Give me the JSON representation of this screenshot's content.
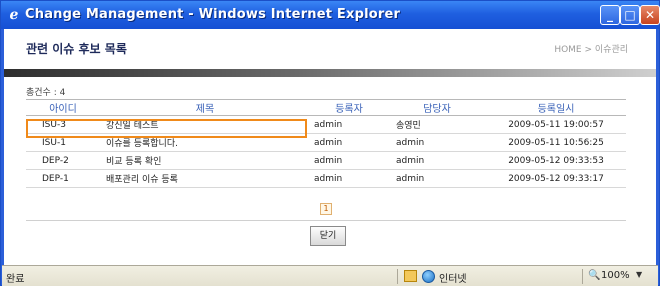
{
  "window": {
    "title": "Change Management - Windows Internet Explorer",
    "ie_icon_glyph": "ℯ",
    "buttons": {
      "min_glyph": "_",
      "max_glyph": "□",
      "close_glyph": "✕"
    }
  },
  "page": {
    "title": "관련 이슈 후보 목록",
    "breadcrumb": "HOME > 이슈관리",
    "count_label": "총건수 : 4",
    "headers": [
      "아이디",
      "제목",
      "등록자",
      "담당자",
      "등록일시"
    ],
    "rows": [
      {
        "id": "ISU-3",
        "title": "강신일 테스트",
        "registrant": "admin",
        "manager": "송영민",
        "date": "2009-05-11 19:00:57"
      },
      {
        "id": "ISU-1",
        "title": "이슈를 등록합니다.",
        "registrant": "admin",
        "manager": "admin",
        "date": "2009-05-11 10:56:25"
      },
      {
        "id": "DEP-2",
        "title": "비교 등록 확인",
        "registrant": "admin",
        "manager": "admin",
        "date": "2009-05-12 09:33:53"
      },
      {
        "id": "DEP-1",
        "title": "배포관리 이슈 등록",
        "registrant": "admin",
        "manager": "admin",
        "date": "2009-05-12 09:33:17"
      }
    ],
    "pager": {
      "current": "1"
    },
    "close_button": "닫기"
  },
  "status": {
    "text": "완료",
    "zone": "인터넷",
    "zoom": "100%",
    "zoom_icon_glyph": "🔍",
    "zoom_arrow_glyph": "▼"
  },
  "colors": {
    "highlight": "#f08a1a",
    "titlebar": "#1f5fe0",
    "header_text": "#3a62b8"
  }
}
